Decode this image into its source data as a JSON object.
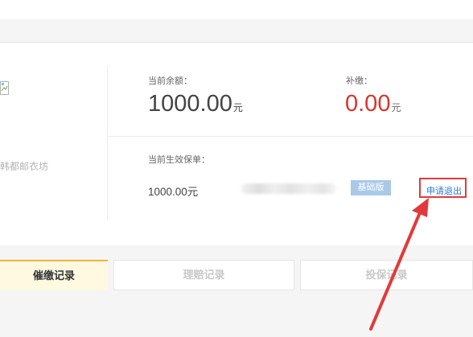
{
  "account": {
    "shop_name": "韩都邮衣坊"
  },
  "balance": {
    "label": "当前余额：",
    "value": "1000.00",
    "unit": "元"
  },
  "supplement": {
    "label": "补缴：",
    "value": "0.00",
    "unit": "元"
  },
  "policy": {
    "label": "当前生效保单：",
    "amount": "1000.00元",
    "badge": "基础版",
    "exit_label": "申请退出"
  },
  "tabs": [
    {
      "label": "催缴记录",
      "active": true
    },
    {
      "label": "理赔记录",
      "active": false
    },
    {
      "label": "投保记录",
      "active": false
    }
  ],
  "colors": {
    "accent_red": "#d9342b",
    "link_blue": "#2c7ad6",
    "badge_blue": "#a9c9e9",
    "tab_active_bg": "#fff9e1",
    "tab_active_border": "#f1b43a",
    "annotation_red": "#e23a3a"
  }
}
